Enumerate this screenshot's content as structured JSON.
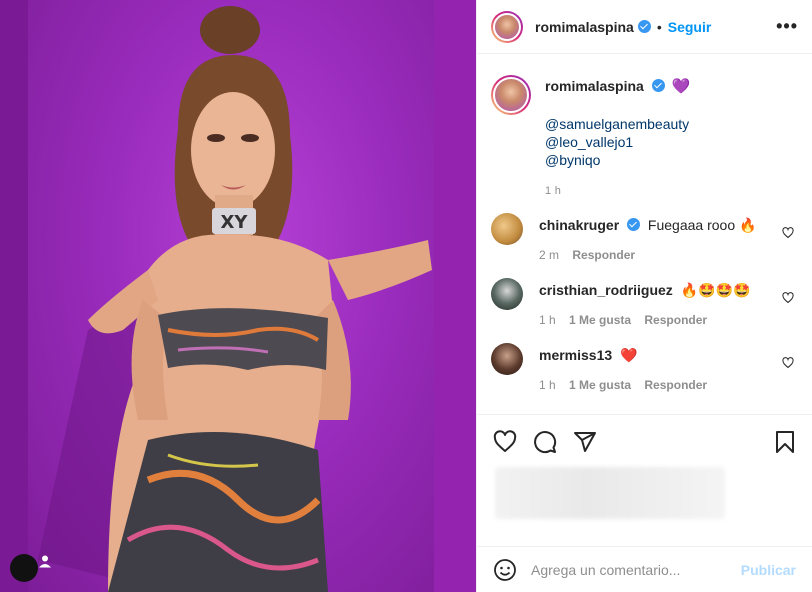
{
  "post": {
    "author": "romimalaspina",
    "verified": true,
    "follow_label": "Seguir",
    "separator": "•",
    "more_label": "•••"
  },
  "caption": {
    "author": "romimalaspina",
    "emoji": "💜",
    "mentions": [
      "@samuelganembeauty",
      "@leo_vallejo1",
      "@byniqo"
    ],
    "time": "1 h"
  },
  "comments": [
    {
      "user": "chinakruger",
      "verified": true,
      "text": "Fuegaaa rooo 🔥",
      "time": "2 m",
      "likes": "",
      "reply": "Responder",
      "avatar_color": "#c08a3e"
    },
    {
      "user": "cristhian_rodriiguez",
      "verified": false,
      "text": "🔥🤩🤩🤩",
      "time": "1 h",
      "likes": "1 Me gusta",
      "reply": "Responder",
      "avatar_color": "#3a4a44"
    },
    {
      "user": "mermiss13",
      "verified": false,
      "text": "❤️",
      "time": "1 h",
      "likes": "1 Me gusta",
      "reply": "Responder",
      "avatar_color": "#5b3a2c"
    }
  ],
  "actions": {
    "like_icon": "heart-icon",
    "comment_icon": "comment-icon",
    "share_icon": "share-icon",
    "save_icon": "bookmark-icon"
  },
  "comment_box": {
    "placeholder": "Agrega un comentario...",
    "publish_label": "Publicar",
    "emoji_icon": "smiley-icon"
  },
  "media": {
    "background_color": "#9a2cbd",
    "user_tag_icon": "user-icon"
  }
}
